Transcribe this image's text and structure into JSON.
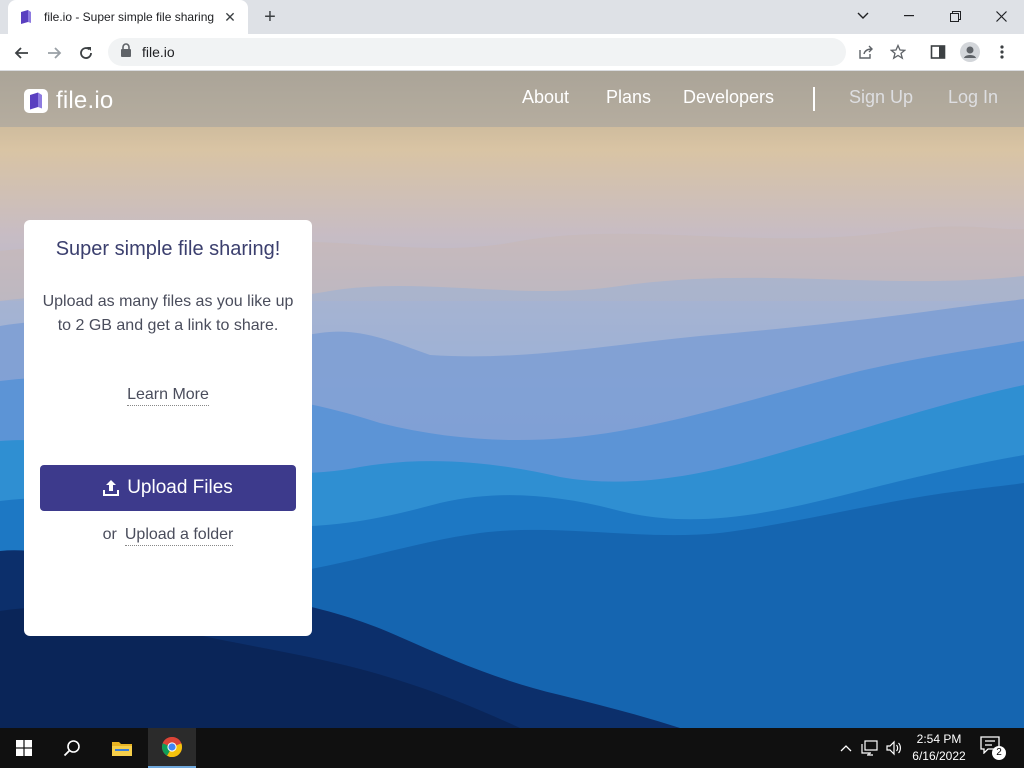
{
  "browser": {
    "tab": {
      "title": "file.io - Super simple file sharing",
      "favicon": "fileio-logo-icon"
    },
    "address": {
      "url": "file.io",
      "secure": true
    }
  },
  "site": {
    "logo": "file.io",
    "nav": {
      "about": "About",
      "plans": "Plans",
      "developers": "Developers",
      "signup": "Sign Up",
      "login": "Log In"
    },
    "card": {
      "title": "Super simple file sharing!",
      "description": "Upload as many files as you like up to 2 GB and get a link to share.",
      "learn_more": "Learn More",
      "upload_button": "Upload Files",
      "or": "or",
      "upload_folder": "Upload a folder"
    },
    "colors": {
      "primary_button": "#3d3a8c",
      "brand_purple": "#5a3fc0"
    }
  },
  "taskbar": {
    "apps": [
      "start-icon",
      "search-icon",
      "file-explorer-icon",
      "chrome-icon"
    ],
    "active_app": "chrome-icon",
    "tray": [
      "chevron-up-icon",
      "network-icon",
      "volume-icon"
    ],
    "clock": {
      "time": "2:54 PM",
      "date": "6/16/2022"
    },
    "notifications": "2"
  }
}
